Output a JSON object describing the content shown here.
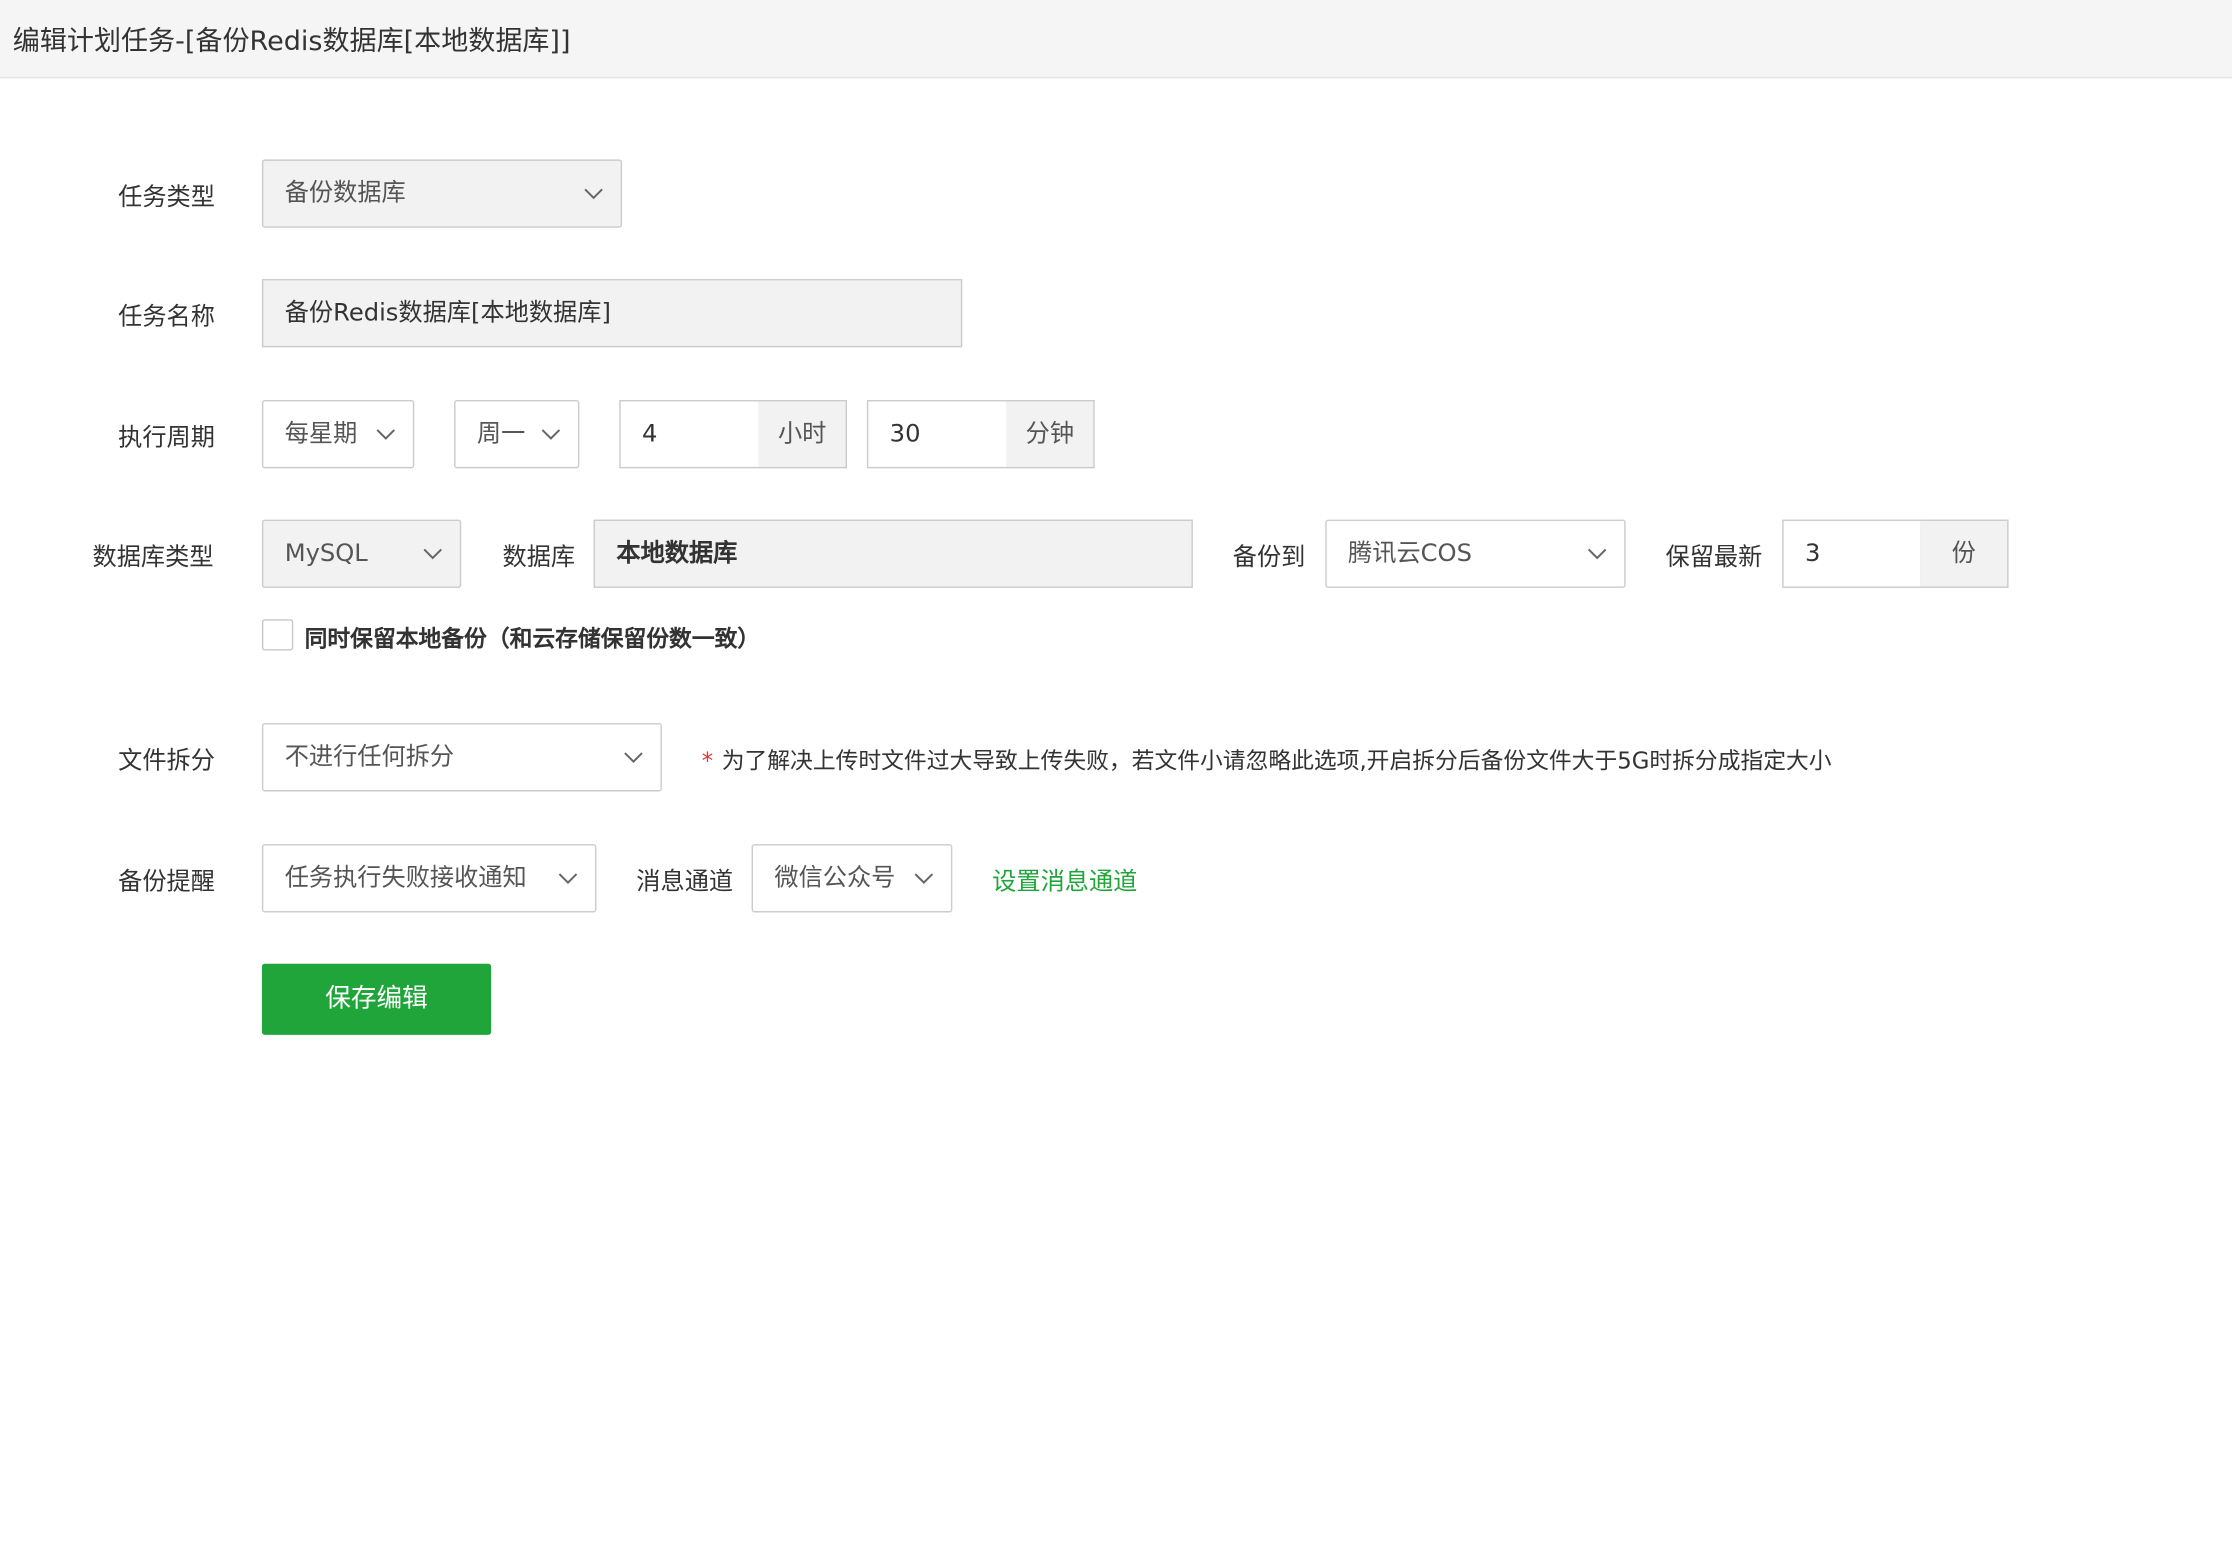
{
  "header": {
    "title": "编辑计划任务-[备份Redis数据库[本地数据库]]"
  },
  "form": {
    "task_type": {
      "label": "任务类型",
      "value": "备份数据库"
    },
    "task_name": {
      "label": "任务名称",
      "value": "备份Redis数据库[本地数据库]"
    },
    "cycle": {
      "label": "执行周期",
      "period": "每星期",
      "weekday": "周一",
      "hour": "4",
      "hour_unit": "小时",
      "minute": "30",
      "minute_unit": "分钟"
    },
    "database": {
      "type_label": "数据库类型",
      "type_value": "MySQL",
      "db_label": "数据库",
      "db_value": "本地数据库",
      "backup_to_label": "备份到",
      "backup_to_value": "腾讯云COS",
      "keep_label": "保留最新",
      "keep_value": "3",
      "keep_unit": "份",
      "local_backup_checkbox": "同时保留本地备份（和云存储保留份数一致）"
    },
    "split": {
      "label": "文件拆分",
      "value": "不进行任何拆分",
      "hint_star": "*",
      "hint": "为了解决上传时文件过大导致上传失败，若文件小请忽略此选项,开启拆分后备份文件大于5G时拆分成指定大小"
    },
    "notify": {
      "label": "备份提醒",
      "value": "任务执行失败接收通知",
      "channel_label": "消息通道",
      "channel_value": "微信公众号",
      "set_channel_link": "设置消息通道"
    },
    "save_button": "保存编辑"
  },
  "colors": {
    "accent": "#20a53a",
    "required_star": "#e03636",
    "header_bg": "#f5f5f5"
  }
}
